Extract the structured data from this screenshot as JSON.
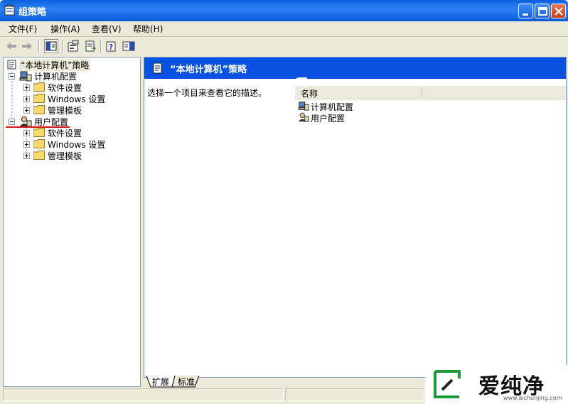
{
  "window": {
    "title": "组策略"
  },
  "menu": [
    {
      "label": "文件(F)"
    },
    {
      "label": "操作(A)"
    },
    {
      "label": "查看(V)"
    },
    {
      "label": "帮助(H)"
    }
  ],
  "tree": {
    "root": "“本地计算机”策略",
    "computer": {
      "label": "计算机配置",
      "children": [
        "软件设置",
        "Windows 设置",
        "管理模板"
      ]
    },
    "user": {
      "label": "用户配置",
      "children": [
        "软件设置",
        "Windows 设置",
        "管理模板"
      ]
    }
  },
  "right": {
    "header_title": "“本地计算机”策略",
    "description": "选择一个项目来查看它的描述。",
    "column_name": "名称",
    "rows": [
      "计算机配置",
      "用户配置"
    ]
  },
  "tabs": {
    "expanded": "扩展",
    "standard": "标准"
  },
  "watermark": {
    "text": "爱纯净",
    "url": "www.aichunjing.com"
  },
  "colors": {
    "titlebar": "#0a5fe0",
    "header_band": "#0a53e0",
    "annotation": "#d11111"
  }
}
